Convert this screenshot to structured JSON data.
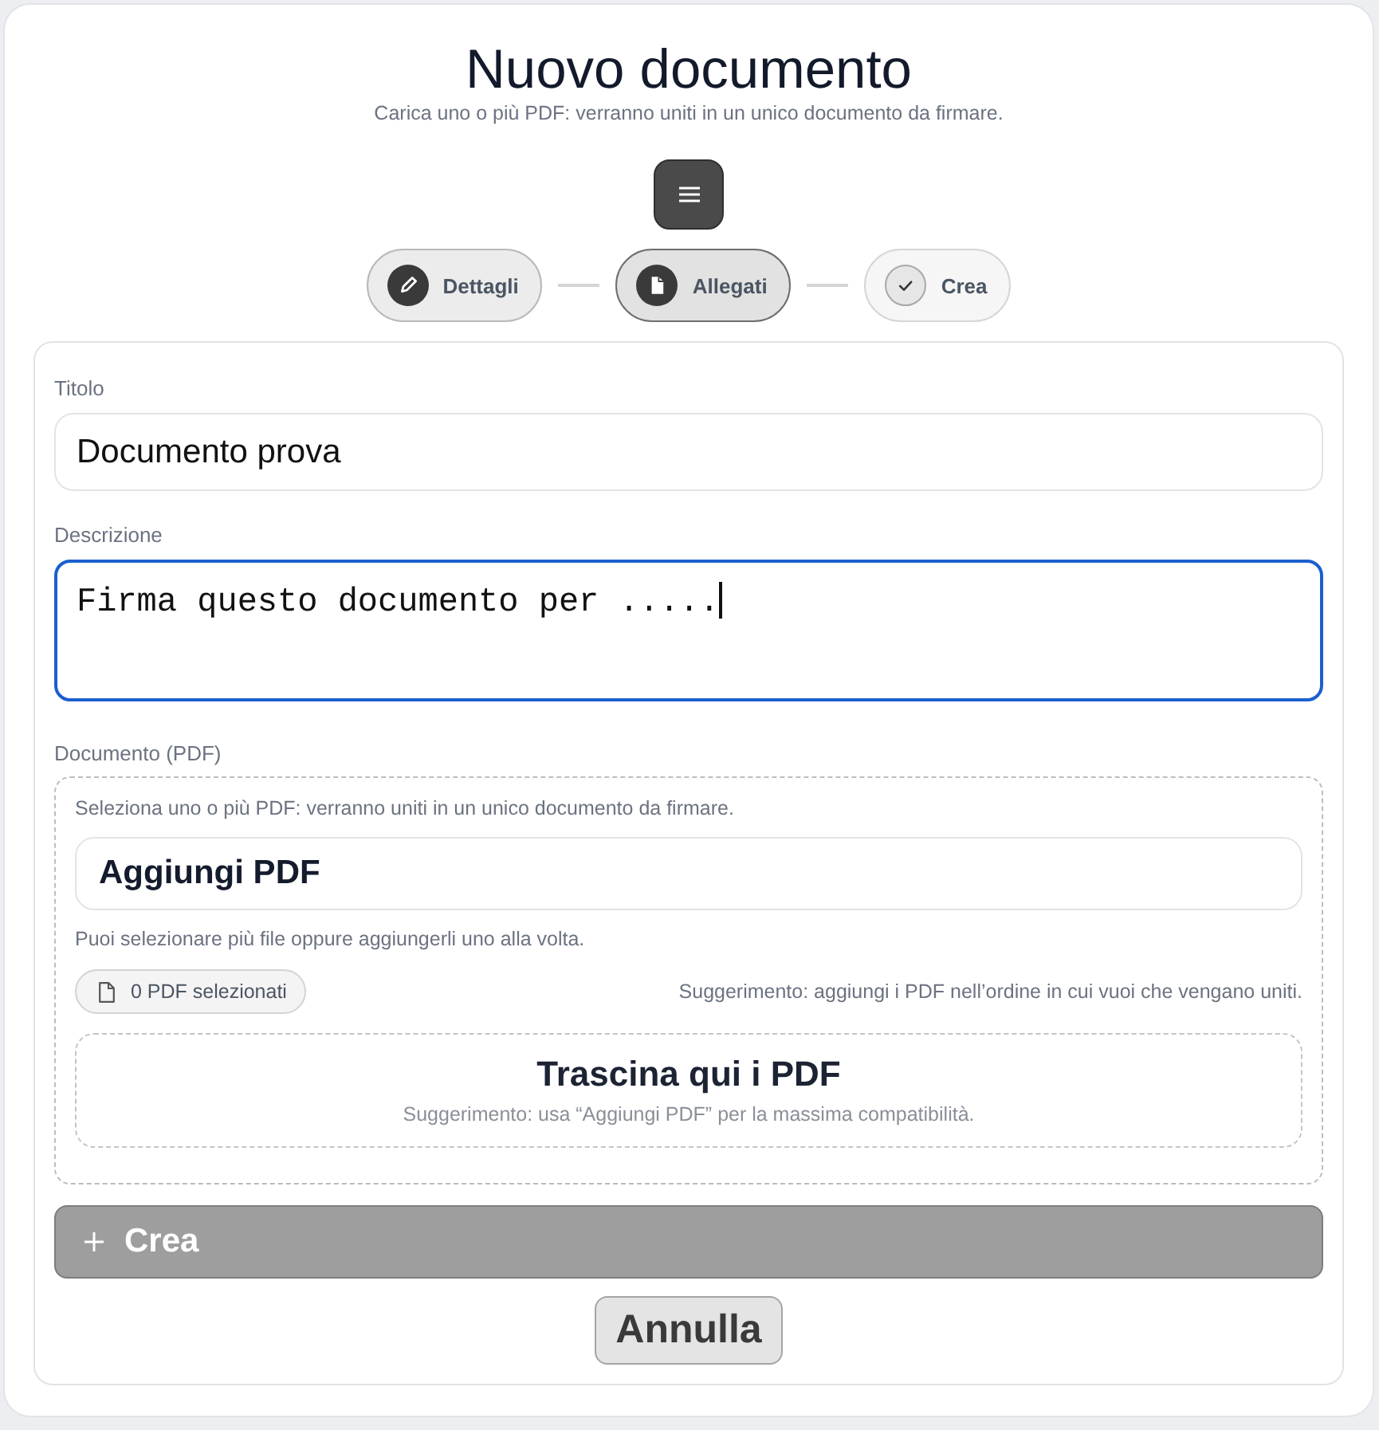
{
  "header": {
    "title": "Nuovo documento",
    "subtitle": "Carica uno o più PDF: verranno uniti in un unico documento da firmare."
  },
  "steps": [
    {
      "label": "Dettagli",
      "selected": false,
      "disabled": false
    },
    {
      "label": "Allegati",
      "selected": true,
      "disabled": false
    },
    {
      "label": "Crea",
      "selected": false,
      "disabled": true
    }
  ],
  "form": {
    "fields": [
      {
        "kind": "input",
        "label": "Titolo",
        "value": "Documento prova",
        "focused": false
      },
      {
        "kind": "textarea",
        "label": "Descrizione",
        "value": "Firma questo documento per .....",
        "focused": true
      }
    ],
    "upload": {
      "label": "Documento (PDF)",
      "intro": "Seleziona uno o più PDF: verranno uniti in un unico documento da firmare.",
      "add_button": "Aggiungi PDF",
      "help": "Puoi selezionare più file oppure aggiungerli uno alla volta.",
      "count_badge": "0 PDF selezionati",
      "tip": "Suggerimento: aggiungi i PDF nell’ordine in cui vuoi che vengano uniti.",
      "dropzone": {
        "title": "Trascina qui i PDF",
        "hint": "Suggerimento: usa “Aggiungi PDF” per la massima compatibilità."
      }
    },
    "actions": [
      {
        "kind": "primary",
        "label": "Crea",
        "disabled": true
      },
      {
        "kind": "secondary",
        "label": "Annulla",
        "disabled": false
      }
    ]
  }
}
